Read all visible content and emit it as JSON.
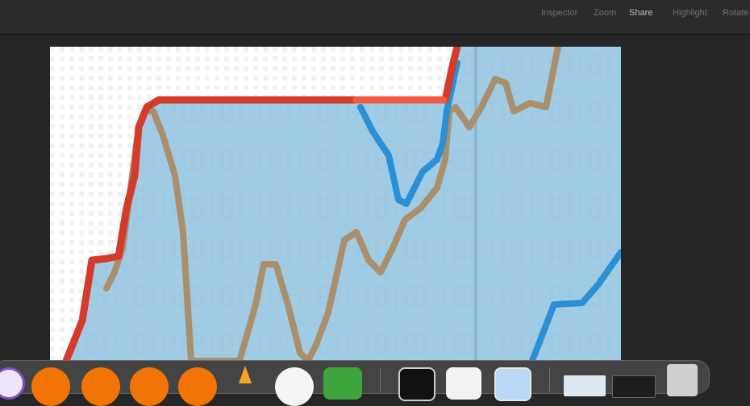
{
  "toolbar": {
    "items": [
      {
        "label": "Inspector",
        "active": false
      },
      {
        "label": "Zoom",
        "active": false
      },
      {
        "label": "Share",
        "active": true
      },
      {
        "label": "Highlight",
        "active": false
      },
      {
        "label": "Rotate",
        "active": false
      }
    ]
  },
  "colors": {
    "toolbar_bg": "#2b2b2b",
    "window_bg": "#262626",
    "chart_fill": "#9ecae3",
    "chart_white": "#ffffff",
    "line_red": "#d63a2a",
    "line_blue": "#2a8fd4",
    "line_brown": "#a98f6c",
    "dock_orange": "#f27405"
  },
  "dock": {
    "icons": [
      {
        "name": "purple-app-icon"
      },
      {
        "name": "orange-app-icon"
      },
      {
        "name": "orange-app-icon"
      },
      {
        "name": "orange-app-icon"
      },
      {
        "name": "orange-app-icon"
      },
      {
        "name": "vlc-cone-icon"
      },
      {
        "name": "android-app-icon"
      },
      {
        "name": "numbers-grid-icon"
      },
      {
        "name": "terminal-icon"
      },
      {
        "name": "vscode-icon"
      },
      {
        "name": "finder-window-icon"
      },
      {
        "name": "screenshot-thumbnail-icon"
      },
      {
        "name": "screenshot-thumbnail-icon"
      },
      {
        "name": "trash-icon"
      }
    ]
  }
}
